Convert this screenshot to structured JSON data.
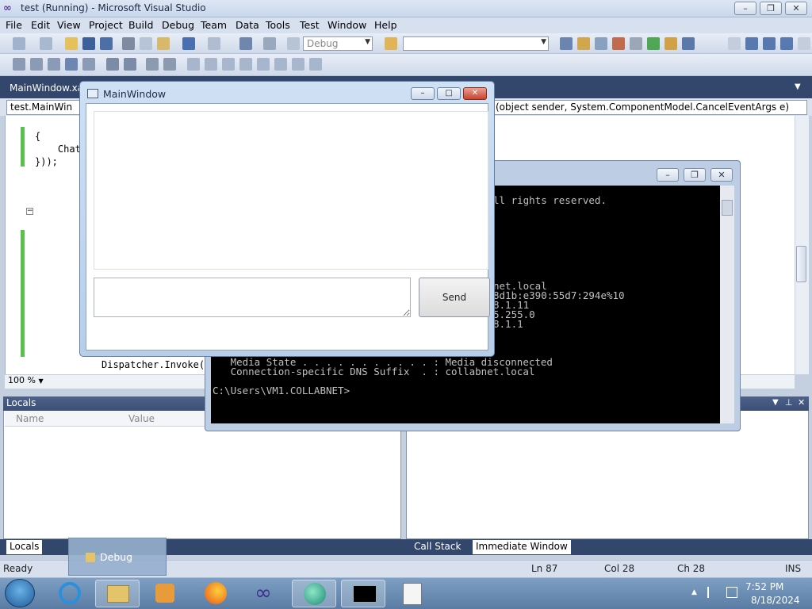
{
  "vs": {
    "title": "test (Running) - Microsoft Visual Studio",
    "menu": [
      "File",
      "Edit",
      "View",
      "Project",
      "Build",
      "Debug",
      "Team",
      "Data",
      "Tools",
      "Test",
      "Window",
      "Help"
    ],
    "config_combo": "Debug",
    "doc_tab": "MainWindow.xar",
    "nav_left": "test.MainWin",
    "nav_right": "(object sender, System.ComponentModel.CancelEventArgs e)",
    "code_lines": [
      "{",
      "    Chat",
      "}));",
      "Dispatcher.Invoke("
    ],
    "zoom": "100 %",
    "locals_title": "Locals",
    "locals_cols": [
      "Name",
      "Value"
    ],
    "bottom_tabs": [
      "Locals",
      "Call Stack",
      "Immediate Window"
    ]
  },
  "status": {
    "ready": "Ready",
    "ln": "Ln 87",
    "col": "Col 28",
    "ch": "Ch 28",
    "ins": "INS"
  },
  "console": {
    "lines": [
      "ll rights reserved.",
      "net.local",
      "8d1b:e390:55d7:294e%10",
      "8.1.11",
      "5.255.0",
      "8.1.1",
      "   Media State . . . . . . . . . . . : Media disconnected",
      "   Connection-specific DNS Suffix  . : collabnet.local",
      "C:\\Users\\VM1.COLLABNET>"
    ]
  },
  "mainwindow": {
    "title": "MainWindow",
    "send_label": "Send"
  },
  "taskbar": {
    "popup_label": "Debug",
    "time": "7:52 PM",
    "date": "8/18/2024"
  }
}
